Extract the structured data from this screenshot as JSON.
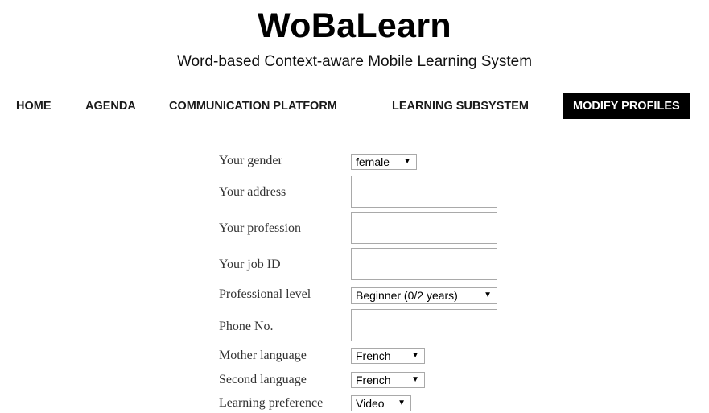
{
  "header": {
    "title": "WoBaLearn",
    "subtitle": "Word-based Context-aware Mobile Learning System"
  },
  "nav": {
    "items": [
      {
        "label": "HOME"
      },
      {
        "label": "AGENDA"
      },
      {
        "label": "COMMUNICATION PLATFORM"
      },
      {
        "label": "LEARNING SUBSYSTEM"
      },
      {
        "label": "MODIFY PROFILES",
        "active": true
      }
    ]
  },
  "form": {
    "gender": {
      "label": "Your gender",
      "value": "female"
    },
    "address": {
      "label": "Your address",
      "value": ""
    },
    "profession": {
      "label": "Your profession",
      "value": ""
    },
    "job_id": {
      "label": "Your job ID",
      "value": ""
    },
    "professional_level": {
      "label": "Professional level",
      "value": "Beginner (0/2 years)"
    },
    "phone": {
      "label": "Phone No.",
      "value": ""
    },
    "mother_language": {
      "label": "Mother language",
      "value": "French"
    },
    "second_language": {
      "label": "Second language",
      "value": "French"
    },
    "learning_preference": {
      "label": "Learning preference",
      "value": "Video"
    }
  },
  "icons": {
    "dropdown_arrow": "▼"
  },
  "colors": {
    "active_nav_bg": "#000000",
    "active_nav_text": "#ffffff",
    "field_border": "#a9a9a9"
  }
}
